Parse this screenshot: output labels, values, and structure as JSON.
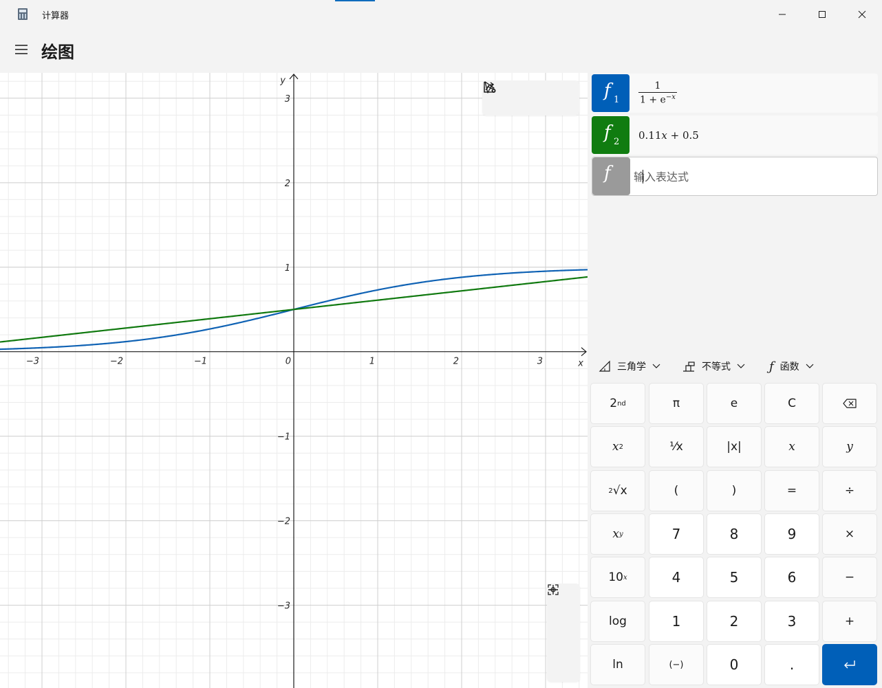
{
  "window": {
    "title": "计算器"
  },
  "header": {
    "title": "绘图",
    "menu_icon": "hamburger-icon"
  },
  "graph": {
    "x_axis_label": "x",
    "y_axis_label": "y",
    "x_tick_labels": [
      "−3",
      "−2",
      "−1",
      "0",
      "1",
      "2",
      "3"
    ],
    "y_tick_labels": [
      "3",
      "2",
      "1",
      "−1",
      "−2",
      "−3"
    ],
    "toolbar": [
      "trace-pointer-icon",
      "share-icon",
      "graph-options-icon"
    ],
    "zoom": [
      "zoom-in-icon",
      "zoom-out-icon",
      "reset-view-icon"
    ]
  },
  "chart_data": {
    "type": "line",
    "xlim": [
      -3.5,
      3.5
    ],
    "ylim": [
      -3.98,
      3.3
    ],
    "grid": true,
    "series": [
      {
        "name": "f1",
        "expression": "1/(1+e^(−x))",
        "color": "#0f62b4"
      },
      {
        "name": "f2",
        "expression": "0.11x + 0.5",
        "color": "#10790f",
        "slope": 0.11,
        "intercept": 0.5
      }
    ]
  },
  "functions": [
    {
      "letter": "f",
      "sub": "1",
      "numerator": "1",
      "denominator": "1 + e",
      "den_exp": "−x",
      "color": "#005fb8"
    },
    {
      "letter": "f",
      "sub": "2",
      "coef": "0.11",
      "var": "x",
      "tail": " + 0.5",
      "color": "#107c10"
    },
    {
      "letter": "f",
      "placeholder": "输入表达式",
      "color": "#9a9a9a"
    }
  ],
  "dropdowns": [
    {
      "label": "三角学",
      "icon": "triangle-ruler-icon"
    },
    {
      "label": "不等式",
      "icon": "inequality-icon"
    },
    {
      "label": "函数",
      "icon": "function-icon"
    }
  ],
  "keypad": {
    "row1": [
      "2",
      "nd",
      "π",
      "e",
      "C"
    ],
    "row2": [
      "x",
      "2",
      "⅟x",
      "|x|",
      "x",
      "y"
    ],
    "row3": [
      "2",
      "√x",
      "(",
      ")",
      "=",
      "÷"
    ],
    "row4": [
      "x",
      "y",
      "7",
      "8",
      "9",
      "×"
    ],
    "row5": [
      "10",
      "x",
      "4",
      "5",
      "6",
      "−"
    ],
    "row6": [
      "log",
      "1",
      "2",
      "3",
      "+"
    ],
    "row7": [
      "ln",
      "(−)",
      "0",
      "."
    ]
  }
}
